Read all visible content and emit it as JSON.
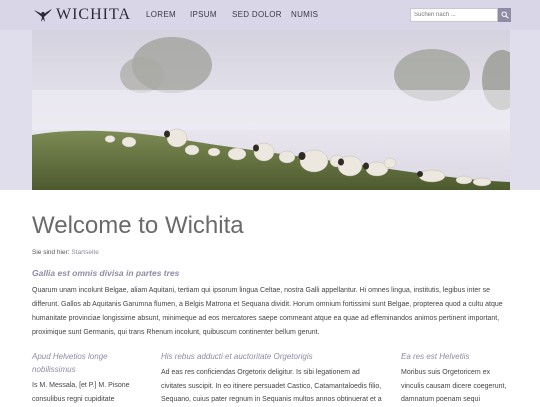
{
  "brand": {
    "name": "WICHITA",
    "logo_icon": "flying-bird-icon"
  },
  "nav": {
    "items": [
      "LOREM",
      "IPSUM",
      "SED DOLOR",
      "NUMIS"
    ]
  },
  "search": {
    "placeholder": "Suchen nach ...",
    "button_icon": "search-icon"
  },
  "page": {
    "title": "Welcome to Wichita",
    "breadcrumb_label": "Sie sind hier:",
    "breadcrumb_link": "Startseite",
    "lead": "Gallia est omnis divisa in partes tres",
    "body": "Quarum unam incolunt Belgae, aliam Aquitani, tertiam qui ipsorum lingua Celtae, nostra Galli appellantur. Hi omnes lingua, institutis, legibus inter se differunt. Gallos ab Aquitanis Garumna flumen, a Belgis Matrona et Sequana dividit. Horum omnium fortissimi sunt Belgae, propterea quod a cultu atque humanitate provinciae longissime absunt, minimeque ad eos mercatores saepe commeant atque ea quae ad effeminandos animos pertinent important, proximique sunt Germanis, qui trans Rhenum incolunt, quibuscum continenter bellum gerunt."
  },
  "columns": [
    {
      "heading": "Apud Helvetios longe nobilissimus",
      "text": "Is M. Messala, [et P.] M. Pisone consulibus regni cupiditate"
    },
    {
      "heading": "His rebus adducti et auctoritate Orgetorigis",
      "text": "Ad eas res conficiendas Orgetorix deligitur. Is sibi legationem ad civitates suscipit. In eo itinere persuadet Castico, Catamantaloedis filio, Sequano, cuius pater regnum in Sequanis multos annos obtinuerat et a"
    },
    {
      "heading": "Ea res est Helvetiis",
      "text": "Moribus suis Orgetoricem ex vinculis causam dicere coegerunt, damnatum poenam sequi"
    }
  ],
  "colors": {
    "accent": "#8e8ba3",
    "header_bg": "#d9d6e8"
  }
}
